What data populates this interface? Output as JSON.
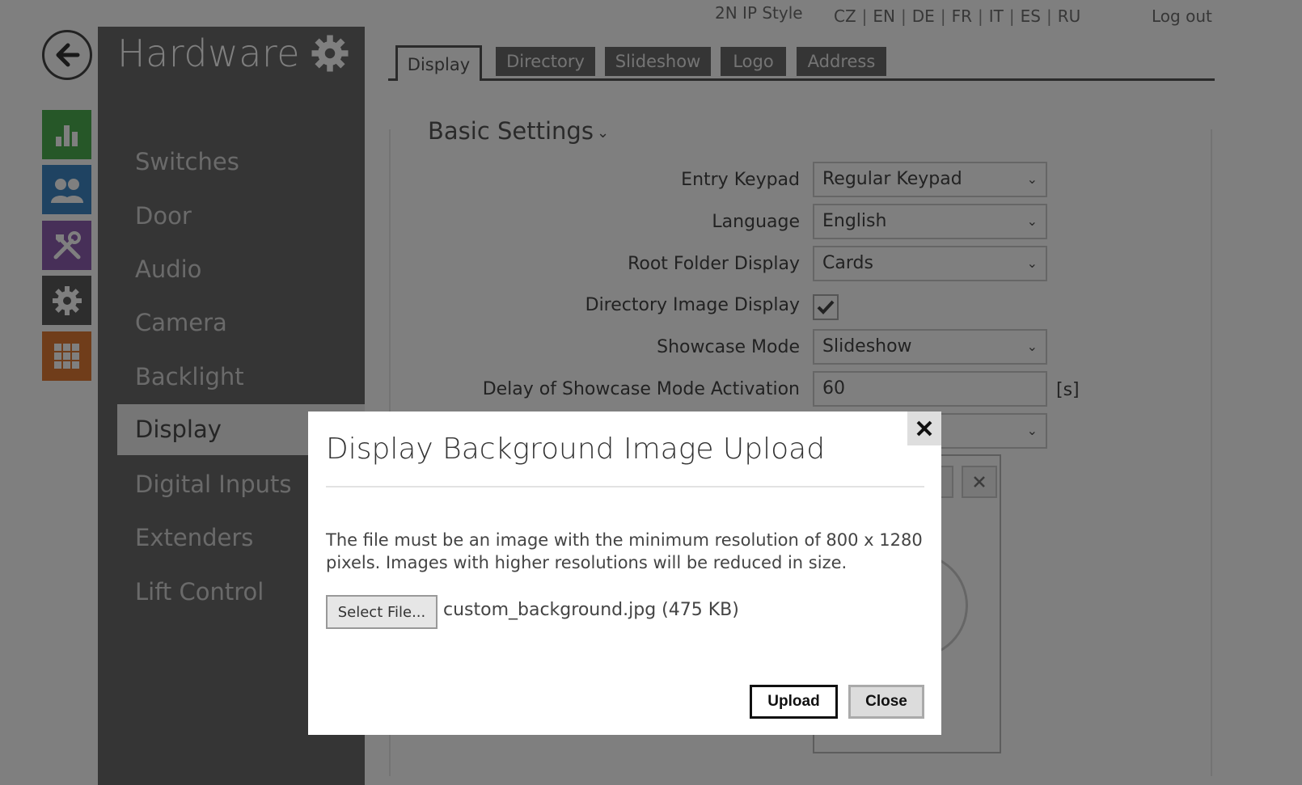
{
  "topbar": {
    "brand": "2N IP Style",
    "languages": [
      "CZ",
      "EN",
      "DE",
      "FR",
      "IT",
      "ES",
      "RU"
    ],
    "logout": "Log out"
  },
  "rail": {
    "colors": {
      "status": "#4caf50",
      "directory": "#3f87c5",
      "hardware": "#8e5fb0",
      "system": "#5a5a5a",
      "services": "#e07a35"
    },
    "icons": [
      "bar-chart-icon",
      "users-icon",
      "tools-icon",
      "gear-icon",
      "grid-icon"
    ]
  },
  "sidebar": {
    "title": "Hardware",
    "items": [
      {
        "label": "Switches"
      },
      {
        "label": "Door"
      },
      {
        "label": "Audio"
      },
      {
        "label": "Camera"
      },
      {
        "label": "Backlight"
      },
      {
        "label": "Display"
      },
      {
        "label": "Digital Inputs"
      },
      {
        "label": "Extenders"
      },
      {
        "label": "Lift Control"
      }
    ],
    "active": "Display"
  },
  "tabs": [
    {
      "label": "Display"
    },
    {
      "label": "Directory"
    },
    {
      "label": "Slideshow"
    },
    {
      "label": "Logo"
    },
    {
      "label": "Address"
    }
  ],
  "settings": {
    "section_title": "Basic Settings",
    "rows": [
      {
        "label": "Entry Keypad",
        "value": "Regular Keypad"
      },
      {
        "label": "Language",
        "value": "English"
      },
      {
        "label": "Root Folder Display",
        "value": "Cards"
      },
      {
        "label": "Directory Image Display",
        "checked": true
      },
      {
        "label": "Showcase Mode",
        "value": "Slideshow"
      },
      {
        "label": "Delay of Showcase Mode Activation",
        "value": "60",
        "unit": "[s]"
      }
    ]
  },
  "modal": {
    "title": "Display Background Image Upload",
    "description": "The file must be an image with the minimum resolution of 800 x 1280 pixels. Images with higher resolutions will be reduced in size.",
    "select_file_label": "Select File...",
    "file_name": "custom_background.jpg (475 KB)",
    "upload_label": "Upload",
    "close_label": "Close"
  }
}
